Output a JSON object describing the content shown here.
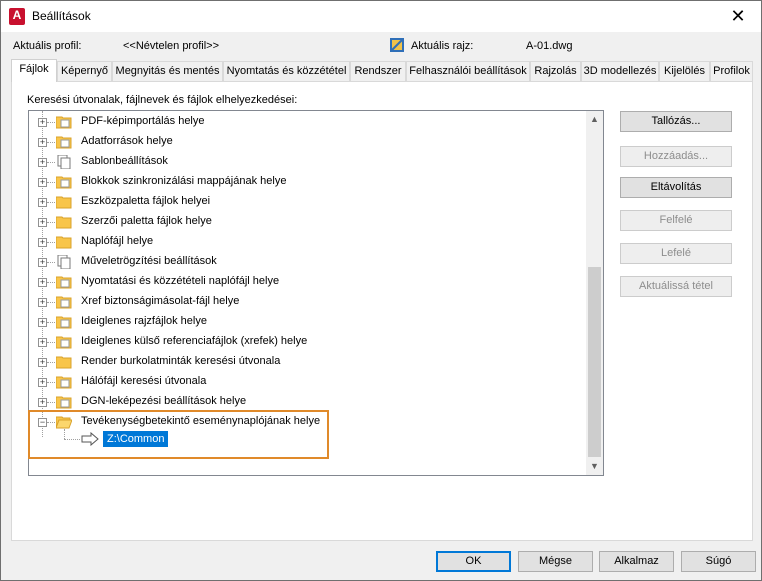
{
  "window": {
    "title": "Beállítások",
    "app_icon_letter": "A"
  },
  "profile": {
    "current_profile_label": "Aktuális profil:",
    "current_profile_value": "<<Névtelen profil>>",
    "current_drawing_label": "Aktuális rajz:",
    "current_drawing_value": "A-01.dwg"
  },
  "tabs": [
    {
      "label": "Fájlok",
      "active": true
    },
    {
      "label": "Képernyő"
    },
    {
      "label": "Megnyitás és mentés"
    },
    {
      "label": "Nyomtatás és közzététel"
    },
    {
      "label": "Rendszer"
    },
    {
      "label": "Felhasználói beállítások"
    },
    {
      "label": "Rajzolás"
    },
    {
      "label": "3D modellezés"
    },
    {
      "label": "Kijelölés"
    },
    {
      "label": "Profilok"
    }
  ],
  "files_panel": {
    "search_label": "Keresési útvonalak, fájlnevek és fájlok elhelyezkedései:",
    "tree_items": [
      {
        "label": "PDF-képimportálás helye",
        "icon": "folder-icon"
      },
      {
        "label": "Adatforrások helye",
        "icon": "folder-icon"
      },
      {
        "label": "Sablonbeállítások",
        "icon": "documents-icon"
      },
      {
        "label": "Blokkok szinkronizálási mappájának helye",
        "icon": "folder-icon"
      },
      {
        "label": "Eszközpaletta fájlok helyei",
        "icon": "folder-icon"
      },
      {
        "label": "Szerzői paletta fájlok helye",
        "icon": "folder-icon"
      },
      {
        "label": "Naplófájl helye",
        "icon": "folder-icon"
      },
      {
        "label": "Műveletrögzítési beállítások",
        "icon": "documents-icon"
      },
      {
        "label": "Nyomtatási és közzétételi naplófájl helye",
        "icon": "folder-icon"
      },
      {
        "label": "Xref biztonságimásolat-fájl helye",
        "icon": "folder-icon"
      },
      {
        "label": "Ideiglenes rajzfájlok helye",
        "icon": "folder-icon"
      },
      {
        "label": "Ideiglenes külső referenciafájlok (xrefek) helye",
        "icon": "folder-icon"
      },
      {
        "label": "Render burkolatminták keresési útvonala",
        "icon": "folder-icon"
      },
      {
        "label": "Hálófájl keresési útvonala",
        "icon": "folder-icon"
      },
      {
        "label": "DGN-leképezési beállítások helye",
        "icon": "folder-icon"
      },
      {
        "label": "Tevékenységbetekintő eseménynaplójának helye",
        "icon": "folder-open-icon",
        "expanded": true
      }
    ],
    "expanded_child": {
      "label": "Z:\\Common",
      "selected": true
    },
    "accent_highlight_color": "#e08a2a",
    "selection_color": "#0078d7"
  },
  "side_buttons": [
    {
      "label": "Tallózás...",
      "enabled": true
    },
    {
      "label": "Hozzáadás...",
      "enabled": false
    },
    {
      "label": "Eltávolítás",
      "enabled": true
    },
    {
      "label": "Felfelé",
      "enabled": false
    },
    {
      "label": "Lefelé",
      "enabled": false
    },
    {
      "label": "Aktuálissá tétel",
      "enabled": false
    }
  ],
  "bottom_buttons": {
    "ok": "OK",
    "cancel": "Mégse",
    "apply": "Alkalmaz",
    "help": "Súgó"
  }
}
